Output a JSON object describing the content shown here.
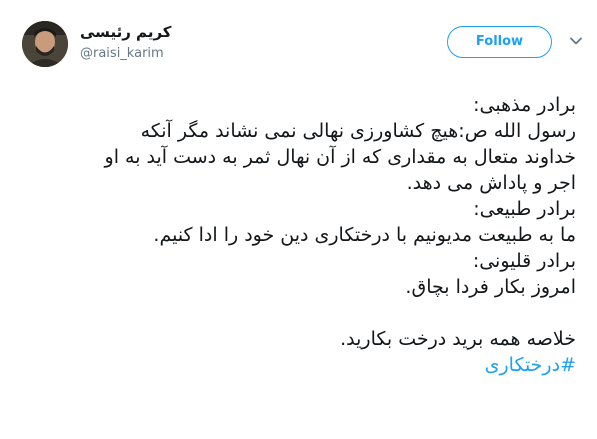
{
  "author": {
    "name": "کریم رئیسی",
    "handle": "@raisi_karim"
  },
  "follow_button": {
    "label": "Follow"
  },
  "menu": {
    "icon": "chevron-down-icon"
  },
  "tweet": {
    "lines": [
      "برادر مذهبی:",
      "رسول الله ص:هیچ کشاورزی نهالی نمی نشاند مگر آنکه",
      "خداوند متعال به مقداری که از آن نهال ثمر به دست آید به او",
      "اجر و پاداش می دهد.",
      "برادر طبیعی:",
      "ما به طبیعت مدیونیم با درختکاری دین خود را ادا کنیم.",
      "برادر قلیونی:",
      "امروز بکار فردا بچاق.",
      "",
      "خلاصه همه برید درخت بکارید."
    ],
    "hashtag": "#درختکاری"
  },
  "colors": {
    "accent": "#1da1f2",
    "text": "#14171a",
    "muted": "#657786"
  }
}
